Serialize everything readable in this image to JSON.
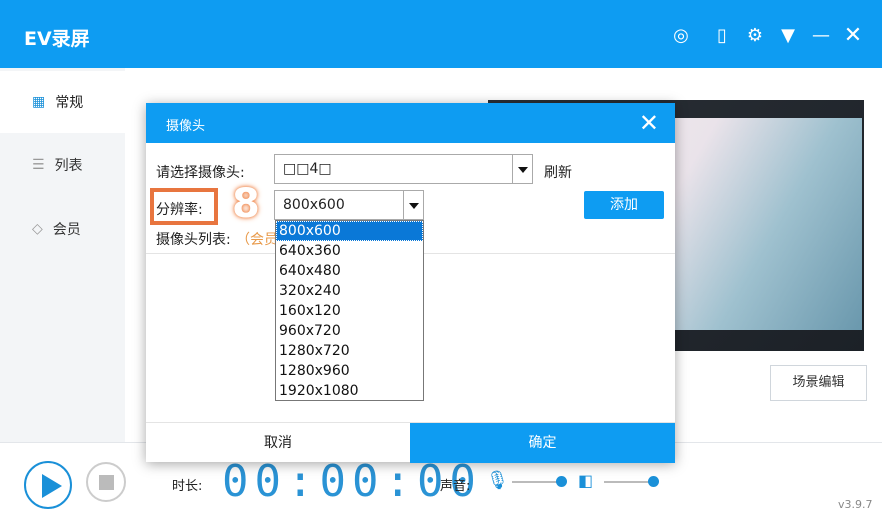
{
  "app": {
    "title": "EV录屏",
    "version": "v3.9.7",
    "accent": "#0e9cf2"
  },
  "titlebar_icons": [
    "user-icon",
    "tablet-icon",
    "gear-icon",
    "menu-down-icon",
    "minimize-icon",
    "close-icon"
  ],
  "sidebar": {
    "items": [
      {
        "label": "常规",
        "icon": "grid-icon",
        "active": true
      },
      {
        "label": "列表",
        "icon": "list-icon"
      },
      {
        "label": "会员",
        "icon": "diamond-icon"
      }
    ]
  },
  "main": {
    "scene_edit": "场景编辑"
  },
  "bottom": {
    "duration_label": "时长:",
    "timer": "00:00:00",
    "sound_label": "声音:"
  },
  "dialog": {
    "title": "摄像头",
    "camera_label": "请选择摄像头:",
    "camera_value": "□□4□",
    "refresh": "刷新",
    "resolution_label": "分辨率:",
    "resolution_value": "800x600",
    "add": "添加",
    "camera_list_label": "摄像头列表:",
    "member_note": "（会员",
    "step_marker": "8",
    "resolution_options": [
      "800x600",
      "640x360",
      "640x480",
      "320x240",
      "160x120",
      "960x720",
      "1280x720",
      "1280x960",
      "1920x1080"
    ],
    "selected_option": "800x600",
    "cancel": "取消",
    "ok": "确定"
  }
}
